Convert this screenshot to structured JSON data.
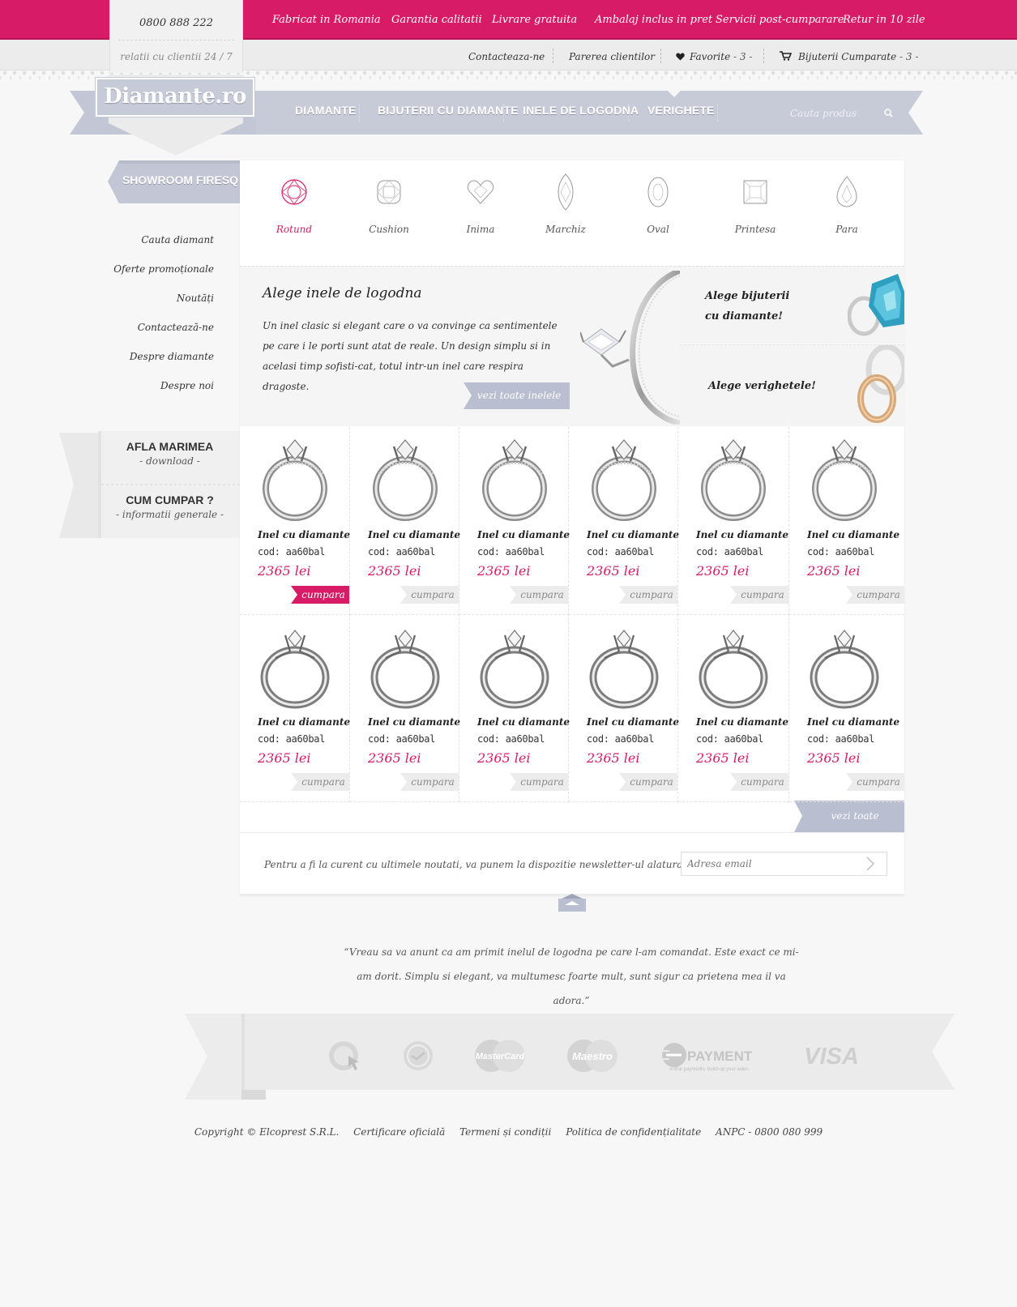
{
  "topbar": {
    "phone": "0800 888 222",
    "hours": "relatii cu clientii 24 / 7",
    "features": [
      "Fabricat in Romania",
      "Garantia calitatii",
      "Livrare gratuita",
      "Ambalaj inclus in pret",
      "Servicii post-cumparare",
      "Retur in 10 zile"
    ],
    "contact": "Contacteaza-ne",
    "reviews": "Parerea clientilor",
    "favorites": "Favorite",
    "favorites_count": "- 3 -",
    "cart": "Bijuterii Cumparate",
    "cart_count": "- 3 -"
  },
  "logo": "Diamante.ro",
  "nav": {
    "items": [
      "DIAMANTE",
      "BIJUTERII CU DIAMANTE",
      "INELE DE LOGODNA",
      "VERIGHETE"
    ],
    "search_placeholder": "Cauta produs"
  },
  "sidebar": {
    "showroom": "SHOWROOM FIRESQ",
    "links": [
      "Cauta diamant",
      "Oferte promoționale",
      "Noutăți",
      "Contactează-ne",
      "Despre diamante",
      "Despre noi"
    ],
    "box1_title": "AFLA MARIMEA",
    "box1_sub": "- download -",
    "box2_title": "CUM CUMPAR ?",
    "box2_sub": "- informatii generale -"
  },
  "shapes": [
    "Rotund",
    "Cushion",
    "Inima",
    "Marchiz",
    "Oval",
    "Printesa",
    "Para"
  ],
  "promo": {
    "title": "Alege inele de logodna",
    "text": "Un inel clasic si elegant care o va convinge ca sentimentele pe care i le porti sunt atat de reale. Un design simplu si in acelasi timp sofisti-cat, totul intr-un inel care respira dragoste.",
    "button": "vezi toate inelele",
    "side1_line1": "Alege bijuterii",
    "side1_line2": "cu diamante!",
    "side2": "Alege verighetele!"
  },
  "products": [
    {
      "name": "Inel cu diamante",
      "code": "cod: aa60bal",
      "price": "2365 lei",
      "buy": "cumpara"
    },
    {
      "name": "Inel cu diamante",
      "code": "cod: aa60bal",
      "price": "2365 lei",
      "buy": "cumpara"
    },
    {
      "name": "Inel cu diamante",
      "code": "cod: aa60bal",
      "price": "2365 lei",
      "buy": "cumpara"
    },
    {
      "name": "Inel cu diamante",
      "code": "cod: aa60bal",
      "price": "2365 lei",
      "buy": "cumpara"
    },
    {
      "name": "Inel cu diamante",
      "code": "cod: aa60bal",
      "price": "2365 lei",
      "buy": "cumpara"
    },
    {
      "name": "Inel cu diamante",
      "code": "cod: aa60bal",
      "price": "2365 lei",
      "buy": "cumpara"
    },
    {
      "name": "Inel cu diamante",
      "code": "cod: aa60bal",
      "price": "2365 lei",
      "buy": "cumpara"
    },
    {
      "name": "Inel cu diamante",
      "code": "cod: aa60bal",
      "price": "2365 lei",
      "buy": "cumpara"
    },
    {
      "name": "Inel cu diamante",
      "code": "cod: aa60bal",
      "price": "2365 lei",
      "buy": "cumpara"
    },
    {
      "name": "Inel cu diamante",
      "code": "cod: aa60bal",
      "price": "2365 lei",
      "buy": "cumpara"
    },
    {
      "name": "Inel cu diamante",
      "code": "cod: aa60bal",
      "price": "2365 lei",
      "buy": "cumpara"
    },
    {
      "name": "Inel cu diamante",
      "code": "cod: aa60bal",
      "price": "2365 lei",
      "buy": "cumpara"
    }
  ],
  "all_jewels": "vezi toate bijuteriile",
  "newsletter": {
    "text": "Pentru a fi la curent cu ultimele noutati, va punem la dispozitie newsletter-ul alaturat.",
    "placeholder": "Adresa email"
  },
  "testimonial": "“Vreau sa va anunt ca am primit inelul de logodna pe care l-am comandat. Este exact ce mi-am dorit. Simplu si elegant, va multumesc foarte mult, sunt sigur ca prietena mea il va adora.”",
  "payments": {
    "mastercard": "MasterCard",
    "maestro": "Maestro",
    "epayment": "PAYMENT",
    "epayment_sub": "online payments. build-up your sales.",
    "visa": "VISA"
  },
  "footer": [
    "Copyright © Elcoprest S.R.L.",
    "Certificare oficială",
    "Termeni și condiții",
    "Politica de confidențialitate",
    "ANPC - 0800 080 999"
  ],
  "colors": {
    "accent": "#d81b66",
    "ribbon": "#c7cbd8",
    "background": "#f7f7f7"
  }
}
